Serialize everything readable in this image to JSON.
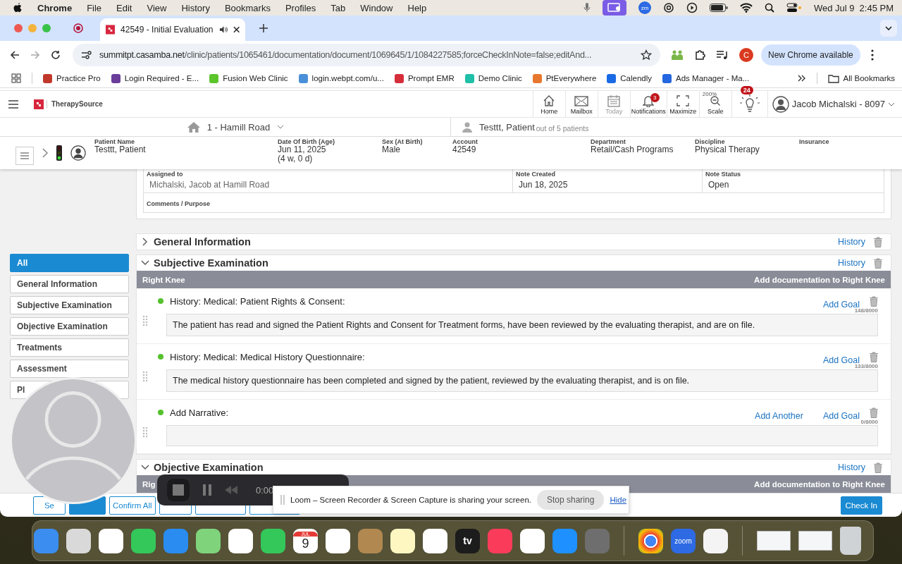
{
  "menu_bar": {
    "app": "Chrome",
    "menus": [
      "File",
      "Edit",
      "View",
      "History",
      "Bookmarks",
      "Profiles",
      "Tab",
      "Window",
      "Help"
    ],
    "zoom_label": "zm",
    "date": "Wed Jul 9",
    "time": "2:45 PM"
  },
  "browser": {
    "tab_title": "42549 - Initial Evaluation",
    "url_host": "summitpt.casamba.net",
    "url_path": "/clinic/patients/1065461/documentation/document/1069645/1/1084227585;forceCheckInNote=false;editAnd...",
    "profile_initial": "C",
    "update_button": "New Chrome available",
    "bookmarks": [
      {
        "label": "Practice Pro",
        "color": "#c0392b"
      },
      {
        "label": "Login Required - E...",
        "color": "#6a3d9a"
      },
      {
        "label": "Fusion Web Clinic",
        "color": "#5cc52b"
      },
      {
        "label": "login.webpt.com/u...",
        "color": "#4a90d9"
      },
      {
        "label": "Prompt EMR",
        "color": "#d62d3a"
      },
      {
        "label": "Demo Clinic",
        "color": "#1fbfa8"
      },
      {
        "label": "PtEverywhere",
        "color": "#e8772e"
      },
      {
        "label": "Calendly",
        "color": "#1a6ae6"
      },
      {
        "label": "Ads Manager - Ma...",
        "color": "#2467e0"
      }
    ],
    "all_bookmarks": "All Bookmarks"
  },
  "app_header": {
    "brand": "TherapySource",
    "nav": [
      {
        "kind": "home",
        "label": "Home",
        "disabled": false
      },
      {
        "kind": "mailbox",
        "label": "Mailbox",
        "disabled": false
      },
      {
        "kind": "today",
        "label": "Today",
        "disabled": true
      },
      {
        "kind": "notifications",
        "label": "Notifications",
        "disabled": false,
        "badge": "3"
      },
      {
        "kind": "maximize",
        "label": "Maximize",
        "disabled": false
      },
      {
        "kind": "scale",
        "label": "Scale",
        "disabled": false,
        "caption": "200%"
      }
    ],
    "tips_badge": "24",
    "user": "Jacob Michalski - 8097"
  },
  "location": "1 - Hamill Road",
  "patient_nav": {
    "name": "Testtt, Patient",
    "count": "out of 5 patients"
  },
  "patient": {
    "fields": [
      {
        "label": "Patient Name",
        "value": "Testtt, Patient"
      },
      {
        "label": "Date Of Birth (Age)",
        "value": "Jun 11, 2025",
        "value_2": "(4 w, 0 d)"
      },
      {
        "label": "Sex (At Birth)",
        "value": "Male"
      },
      {
        "label": "Account",
        "value": "42549"
      },
      {
        "label": "Department",
        "value": "Retail/Cash Programs"
      },
      {
        "label": "Discipline",
        "value": "Physical Therapy"
      },
      {
        "label": "Insurance"
      }
    ]
  },
  "note": {
    "fields": [
      {
        "label": "Assigned to",
        "value": "Michalski, Jacob at Hamill Road"
      },
      {
        "label": "Note Created",
        "value": "Jun 18, 2025"
      },
      {
        "label": "Note Status",
        "value": "Open"
      }
    ],
    "comments_label": "Comments / Purpose"
  },
  "sidebar": {
    "items": [
      {
        "label": "All",
        "selected": true
      },
      {
        "label": "General Information",
        "selected": false
      },
      {
        "label": "Subjective Examination",
        "selected": false
      },
      {
        "label": "Objective Examination",
        "selected": false
      },
      {
        "label": "Treatments",
        "selected": false
      },
      {
        "label": "Assessment",
        "selected": false
      },
      {
        "label": "Pl",
        "selected": false
      }
    ]
  },
  "sections": [
    {
      "title": "General Information",
      "expanded": false,
      "history": "History"
    },
    {
      "title": "Subjective Examination",
      "expanded": true,
      "history": "History",
      "body_part": "Right Knee",
      "add_doc": "Add documentation to Right Knee",
      "items": [
        {
          "label": "History: Medical: Patient Rights & Consent:",
          "actions": [
            "Add Goal"
          ],
          "counter": "148/8000",
          "text": "The patient has read and signed the Patient Rights and Consent for Treatment forms, have been reviewed by the evaluating therapist, and are on file."
        },
        {
          "label": "History: Medical: Medical History Questionnaire:",
          "actions": [
            "Add Goal"
          ],
          "counter": "133/8000",
          "text": "The medical history questionnaire has been completed and signed by the patient, reviewed by the evaluating therapist, and is on file."
        },
        {
          "label": "Add Narrative:",
          "actions": [
            "Add Another",
            "Add Goal"
          ],
          "counter": "0/8000"
        }
      ]
    },
    {
      "title": "Objective Examination",
      "expanded": true,
      "history": "History",
      "body_part": "Rig",
      "add_doc": "Add documentation to Right Knee"
    }
  ],
  "footer": {
    "buttons": [
      {
        "kind": "outline",
        "label": "Se"
      },
      {
        "kind": "primary"
      },
      {
        "kind": "outline",
        "label": "Confirm All"
      },
      {
        "kind": "outline"
      },
      {
        "kind": "outline"
      },
      {
        "kind": "outline"
      }
    ],
    "check_in": "Check In"
  },
  "recorder": {
    "time": "0:00"
  },
  "loom_banner": {
    "message": "Loom – Screen Recorder & Screen Capture is sharing your screen.",
    "stop": "Stop sharing",
    "hide": "Hide"
  },
  "dock": {
    "calendar_month": "JUL",
    "calendar_day": "9",
    "tv_label": "tv",
    "zoom_label": "zoom"
  }
}
